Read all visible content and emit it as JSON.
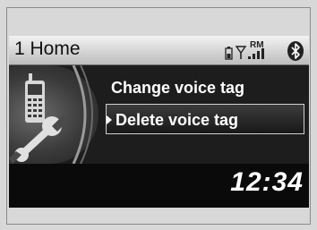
{
  "header": {
    "title": "1 Home",
    "roaming_label": "RM",
    "icons": [
      "phone-battery-icon",
      "signal-antenna-icon",
      "signal-strength-icon",
      "bluetooth-icon"
    ]
  },
  "sidebar": {
    "icons": [
      "mobile-phone-icon",
      "wrench-icon"
    ]
  },
  "menu": {
    "items": [
      {
        "label": "Change voice tag",
        "selected": false
      },
      {
        "label": "Delete voice tag",
        "selected": true
      }
    ]
  },
  "clock": {
    "time": "12:34"
  },
  "colors": {
    "screen_background": "#0a0a0a",
    "header_background": "#e0e0e0",
    "text": "#ffffff",
    "highlight_border": "#d0d0d0"
  }
}
